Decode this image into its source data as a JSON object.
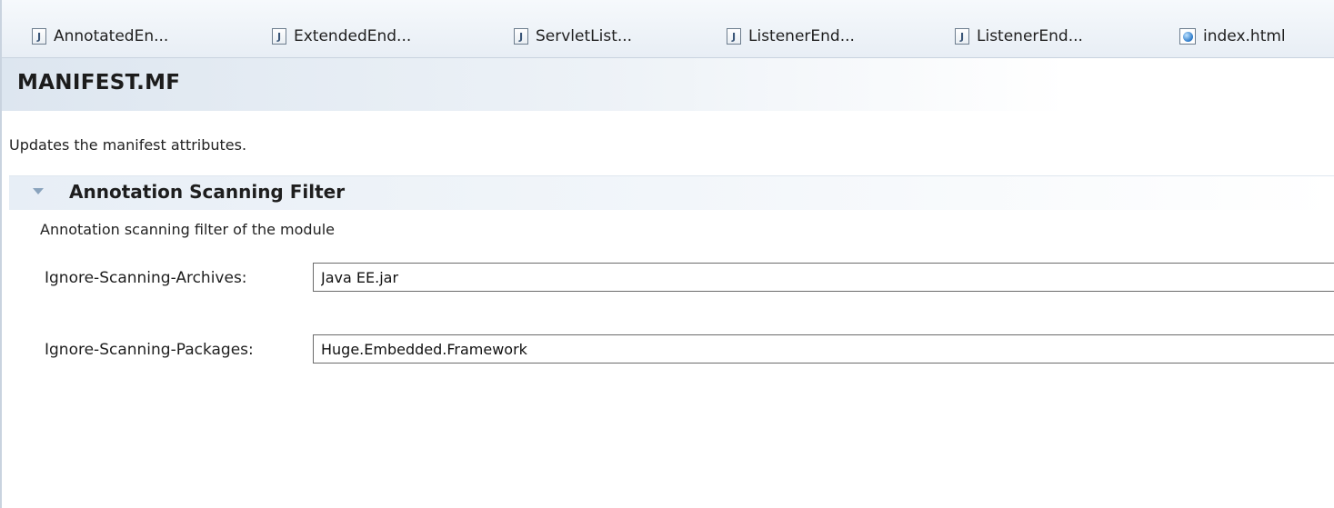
{
  "tabs": [
    {
      "label": "AnnotatedEn...",
      "icon": "java-file-icon"
    },
    {
      "label": "ExtendedEnd...",
      "icon": "java-file-icon"
    },
    {
      "label": "ServletList...",
      "icon": "java-file-icon"
    },
    {
      "label": "ListenerEnd...",
      "icon": "java-file-icon"
    },
    {
      "label": "ListenerEnd...",
      "icon": "java-file-icon"
    },
    {
      "label": "index.html",
      "icon": "html-file-icon"
    }
  ],
  "header": {
    "title": "MANIFEST.MF",
    "description": "Updates the manifest attributes."
  },
  "section": {
    "title": "Annotation Scanning Filter",
    "description": "Annotation scanning filter of the module",
    "fields": [
      {
        "label": "Ignore-Scanning-Archives:",
        "value": "Java EE.jar"
      },
      {
        "label": "Ignore-Scanning-Packages:",
        "value": "Huge.Embedded.Framework"
      }
    ]
  },
  "colors": {
    "header_gradient_start": "#dde6f0",
    "section_gradient_start": "#e7eef6",
    "twistie": "#8aa3bd",
    "input_border": "#6b6b6b"
  }
}
